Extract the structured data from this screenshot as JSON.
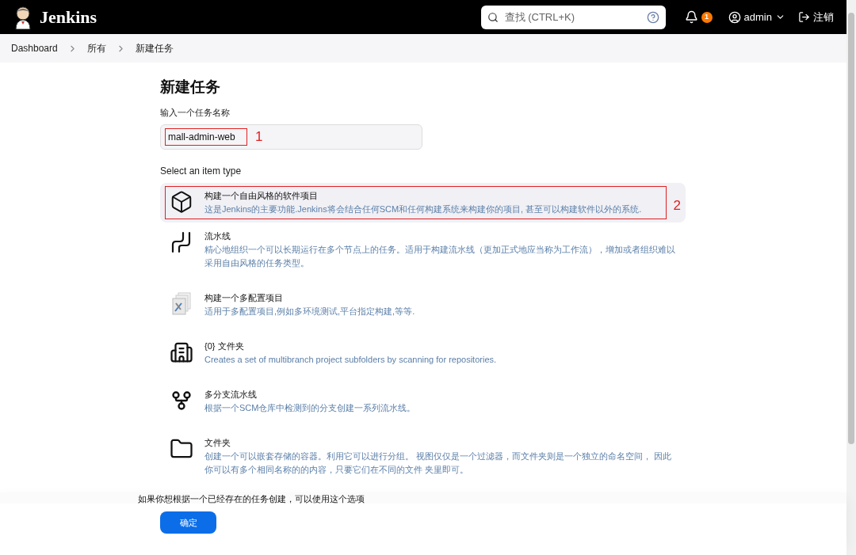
{
  "header": {
    "brand": "Jenkins",
    "search": {
      "placeholder": "查找 (CTRL+K)"
    },
    "notifications": "1",
    "user": "admin",
    "logout": "注销"
  },
  "breadcrumbs": [
    {
      "label": "Dashboard"
    },
    {
      "label": "所有"
    },
    {
      "label": "新建任务"
    }
  ],
  "page_title": "新建任务",
  "name_field": {
    "label": "输入一个任务名称",
    "value": "mall-admin-web",
    "annotation": "1"
  },
  "item_type_label": "Select an item type",
  "item_types": [
    {
      "kind": "freestyle",
      "title": "构建一个自由风格的软件项目",
      "description": "这是Jenkins的主要功能.Jenkins将会结合任何SCM和任何构建系统来构建你的项目, 甚至可以构建软件以外的系统.",
      "selected": true,
      "annotation": "2"
    },
    {
      "kind": "pipeline",
      "title": "流水线",
      "description": "精心地组织一个可以长期运行在多个节点上的任务。适用于构建流水线（更加正式地应当称为工作流），增加或者组织难以采用自由风格的任务类型。",
      "selected": false
    },
    {
      "kind": "matrix",
      "title": "构建一个多配置项目",
      "description": "适用于多配置项目,例如多环境测试,平台指定构建,等等.",
      "selected": false
    },
    {
      "kind": "org-folder",
      "title": "{0} 文件夹",
      "description": "Creates a set of multibranch project subfolders by scanning for repositories.",
      "selected": false
    },
    {
      "kind": "multibranch",
      "title": "多分支流水线",
      "description": "根据一个SCM仓库中检测到的分支创建一系列流水线。",
      "selected": false
    },
    {
      "kind": "folder",
      "title": "文件夹",
      "description": "创建一个可以嵌套存储的容器。利用它可以进行分组。 视图仅仅是一个过滤器，而文件夹则是一个独立的命名空间， 因此你可以有多个相同名称的的内容，只要它们在不同的文件 夹里即可。",
      "selected": false
    }
  ],
  "copy_hint": "如果你想根据一个已经存在的任务创建，可以使用这个选项",
  "ok_button": "确定"
}
